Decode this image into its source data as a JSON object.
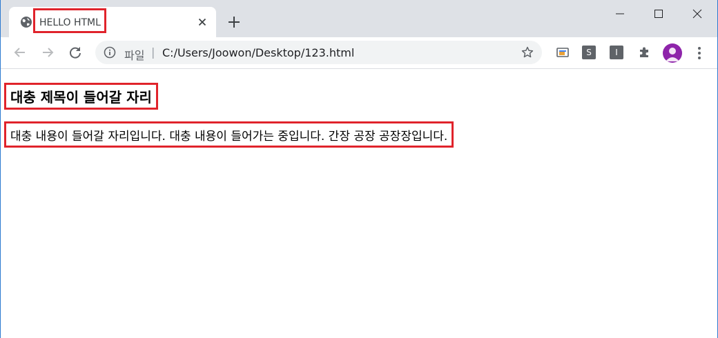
{
  "tab": {
    "title": "HELLO HTML"
  },
  "omnibox": {
    "scheme_label": "파일",
    "separator": "|",
    "url": "C:/Users/Joowon/Desktop/123.html"
  },
  "extensions": {
    "s_label": "S",
    "i_label": "I"
  },
  "page": {
    "heading": "대충 제목이 들어갈 자리",
    "paragraph": "대충 내용이 들어갈 자리입니다. 대충 내용이 들어가는 중입니다. 간장 공장 공장장입니다."
  },
  "icons": {
    "favicon": "globe-icon",
    "tab_close": "close-icon",
    "new_tab": "plus-icon",
    "minimize": "minimize-icon",
    "maximize": "maximize-icon",
    "window_close": "close-icon",
    "back": "arrow-left-icon",
    "forward": "arrow-right-icon",
    "reload": "reload-icon",
    "site_info": "info-icon",
    "bookmark": "star-icon",
    "cast": "cast-icon",
    "extensions": "puzzle-icon",
    "profile": "avatar-icon",
    "menu": "kebab-icon"
  },
  "colors": {
    "highlight_border": "#e0232b",
    "tabstrip_bg": "#dee1e6",
    "omnibox_bg": "#f1f3f4",
    "avatar_bg": "#8e24aa"
  }
}
